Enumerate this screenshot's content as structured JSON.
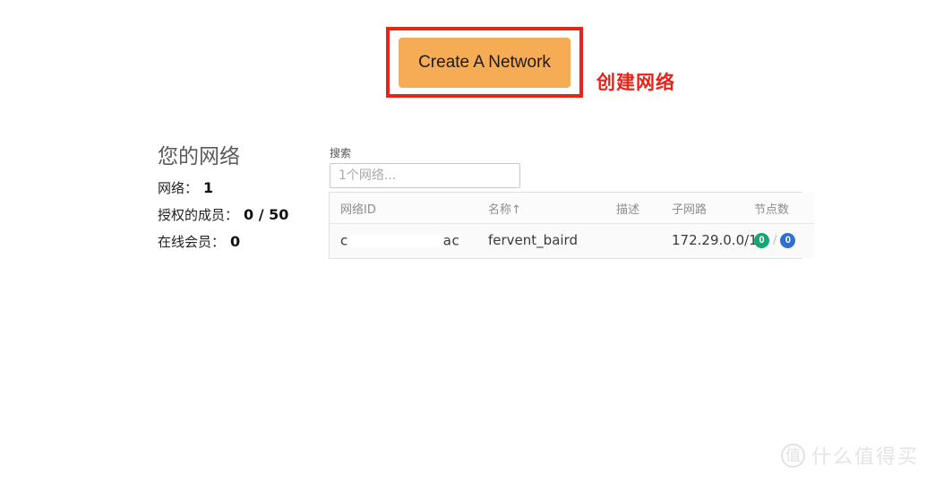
{
  "annotation": {
    "label": "创建网络",
    "box_color": "#e8231a"
  },
  "create_button": {
    "label": "Create A Network",
    "background": "#f6ab55",
    "text_color": "#1c1c1c"
  },
  "stats": {
    "title": "您的网络",
    "rows": [
      {
        "label": "网络：",
        "value": "1"
      },
      {
        "label": "授权的成员：",
        "value": "0 / 50"
      },
      {
        "label": "在线会员：",
        "value": "0"
      }
    ]
  },
  "search": {
    "label": "搜索",
    "placeholder": "1个网络...",
    "value": ""
  },
  "networks_table": {
    "columns": [
      {
        "key": "id",
        "label": "网络ID"
      },
      {
        "key": "name",
        "label": "名称↑"
      },
      {
        "key": "description",
        "label": "描述"
      },
      {
        "key": "subnet",
        "label": "子网路"
      },
      {
        "key": "nodes",
        "label": "节点数"
      }
    ],
    "rows": [
      {
        "id_prefix": "c",
        "id_redacted": true,
        "id_suffix": "ac",
        "name": "fervent_baird",
        "description": "",
        "subnet": "172.29.0.0/16",
        "nodes_online": "0",
        "nodes_total": "0",
        "nodes_separator": "/",
        "online_color": "#17a673",
        "total_color": "#2f6fd0"
      }
    ]
  },
  "watermark": {
    "logo_glyph": "值",
    "text": "什么值得买",
    "color": "#e4e4e4"
  }
}
